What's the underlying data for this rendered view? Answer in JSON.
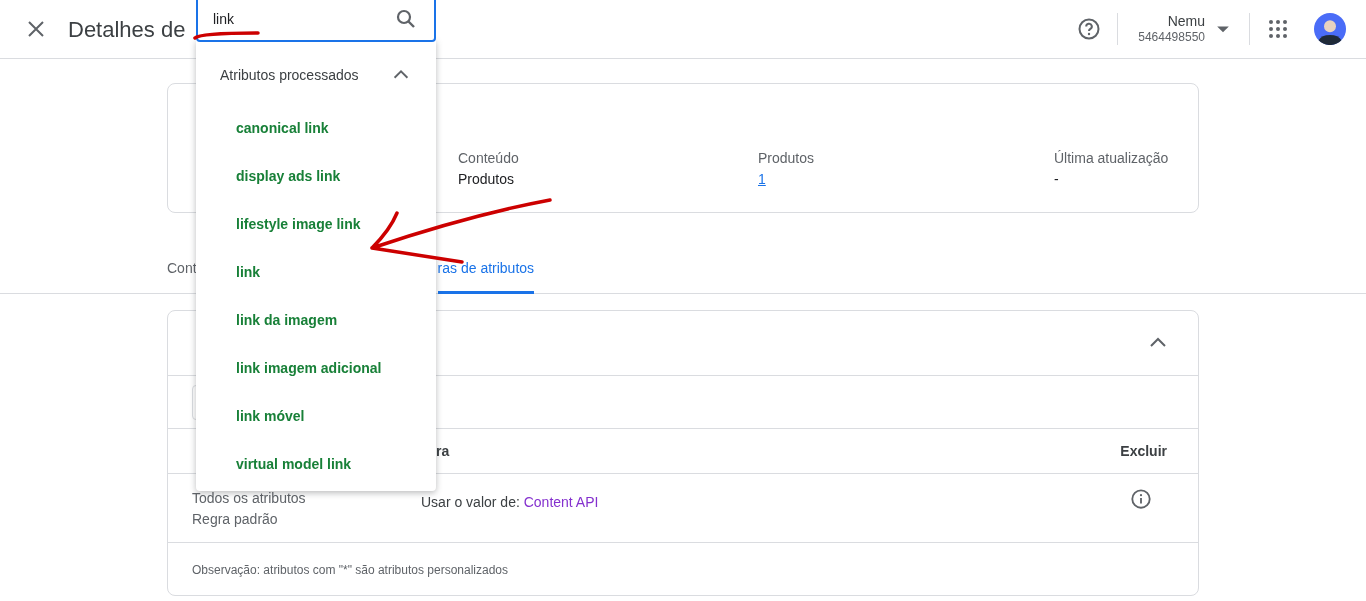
{
  "header": {
    "title": "Detalhes de",
    "account_name": "Nemu",
    "account_id": "5464498550"
  },
  "search": {
    "value": "link"
  },
  "dropdown": {
    "group": "Atributos processados",
    "expanded": true,
    "items": [
      {
        "label": "canonical link"
      },
      {
        "label": "display ads link"
      },
      {
        "label": "lifestyle image link"
      },
      {
        "label": "link"
      },
      {
        "label": "link da imagem"
      },
      {
        "label": "link imagem adicional"
      },
      {
        "label": "link móvel"
      },
      {
        "label": "virtual model link"
      }
    ]
  },
  "summary_card": {
    "fields": [
      {
        "label": "Conteúdo",
        "value": "Produtos",
        "kind": "text"
      },
      {
        "label": "Produtos",
        "value": "1",
        "kind": "link"
      },
      {
        "label": "Última atualização",
        "value": "-",
        "kind": "text"
      }
    ]
  },
  "tabs": [
    {
      "label": "Cont",
      "selected": false
    },
    {
      "label": "ras de atributos",
      "selected": true
    }
  ],
  "section": {
    "expanded": true,
    "columns": [
      "ra",
      "Excluir"
    ],
    "rows": [
      {
        "attribute": "Todos os atributos",
        "note": "Regra padrão",
        "rule_prefix": "Usar o valor de:",
        "rule_source": "Content API"
      }
    ],
    "footnote": "Observação: atributos com \"*\" são atributos personalizados"
  }
}
